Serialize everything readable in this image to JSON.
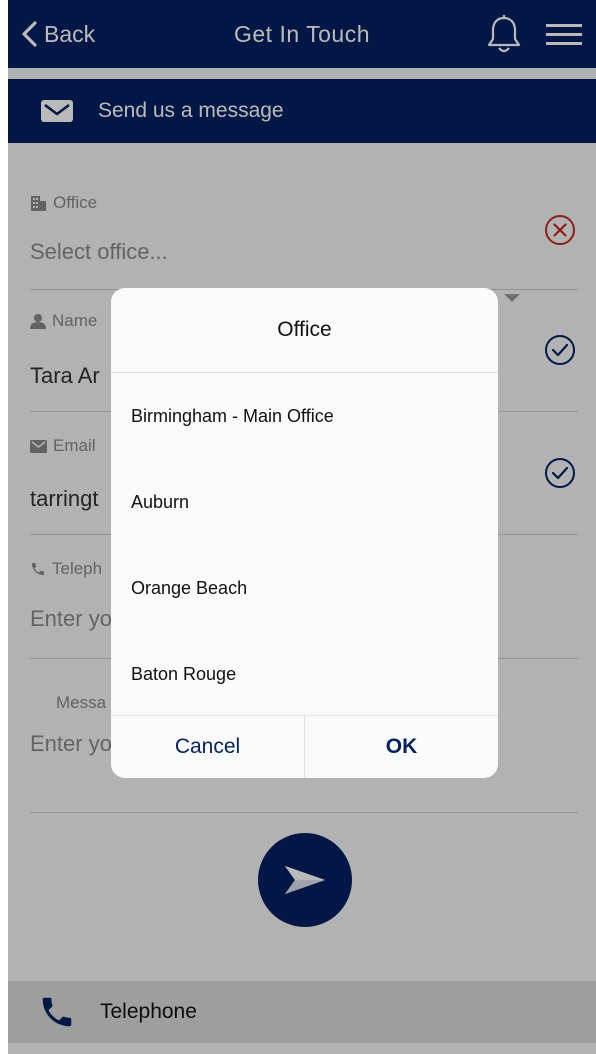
{
  "nav": {
    "back_label": "Back",
    "title": "Get In Touch"
  },
  "subheader": {
    "label": "Send us a message"
  },
  "form": {
    "office": {
      "label": "Office",
      "placeholder": "Select office..."
    },
    "name": {
      "label": "Name",
      "value": "Tara Ar"
    },
    "email": {
      "label": "Email",
      "value": "tarringt"
    },
    "telephone": {
      "label": "Teleph",
      "placeholder": "Enter yo"
    },
    "message": {
      "label": "Messa",
      "placeholder": "Enter yo"
    }
  },
  "footer": {
    "label": "Telephone"
  },
  "dialog": {
    "title": "Office",
    "options": [
      "Birmingham - Main Office",
      "Auburn",
      "Orange Beach",
      "Baton Rouge"
    ],
    "cancel_label": "Cancel",
    "ok_label": "OK"
  },
  "colors": {
    "primary": "#03205f",
    "error": "#c62828",
    "valid": "#03205f",
    "overlay": "rgba(0,0,0,0.27)"
  },
  "icons": [
    "chevron-left-icon",
    "bell-icon",
    "menu-icon",
    "envelope-icon",
    "building-icon",
    "user-icon",
    "mail-icon",
    "phone-icon",
    "dropdown-arrow-icon",
    "error-circle-icon",
    "check-circle-icon",
    "send-icon"
  ]
}
